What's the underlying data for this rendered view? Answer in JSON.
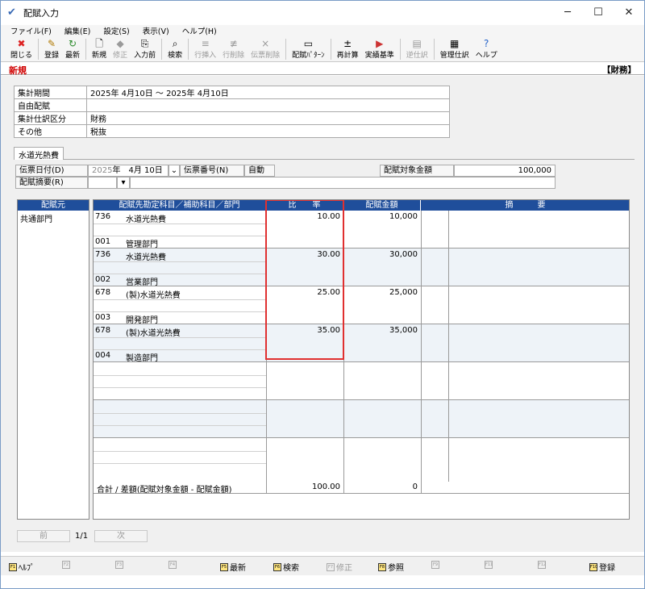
{
  "window": {
    "title": "配賦入力"
  },
  "menu": [
    "ファイル(F)",
    "編集(E)",
    "設定(S)",
    "表示(V)",
    "ヘルプ(H)"
  ],
  "toolbar": [
    {
      "label": "閉じる",
      "icon": "close-icon",
      "enabled": true
    },
    {
      "label": "登録",
      "icon": "save-icon",
      "enabled": true
    },
    {
      "label": "最新",
      "icon": "refresh-icon",
      "enabled": true
    },
    {
      "label": "新規",
      "icon": "new-icon",
      "enabled": true
    },
    {
      "label": "修正",
      "icon": "edit-icon",
      "enabled": false
    },
    {
      "label": "入力前",
      "icon": "prev-input-icon",
      "enabled": true
    },
    {
      "label": "検索",
      "icon": "search-icon",
      "enabled": true
    },
    {
      "label": "行挿入",
      "icon": "row-insert-icon",
      "enabled": false
    },
    {
      "label": "行削除",
      "icon": "row-delete-icon",
      "enabled": false
    },
    {
      "label": "伝票削除",
      "icon": "slip-delete-icon",
      "enabled": false
    },
    {
      "label": "配賦ﾊﾟﾀｰﾝ",
      "icon": "pattern-icon",
      "enabled": true
    },
    {
      "label": "再計算",
      "icon": "recalc-icon",
      "enabled": true
    },
    {
      "label": "実績基準",
      "icon": "actual-icon",
      "enabled": true
    },
    {
      "label": "逆仕訳",
      "icon": "reverse-icon",
      "enabled": false
    },
    {
      "label": "管理仕訳",
      "icon": "manage-icon",
      "enabled": true
    },
    {
      "label": "ヘルプ",
      "icon": "help-icon",
      "enabled": true
    }
  ],
  "status": {
    "mode": "新規",
    "category": "【財務】"
  },
  "info": [
    {
      "label": "集計期間",
      "value": "2025年 4月10日 ～ 2025年 4月10日"
    },
    {
      "label": "自由配賦",
      "value": ""
    },
    {
      "label": "集計仕訳区分",
      "value": "財務"
    },
    {
      "label": "その他",
      "value": "税抜"
    }
  ],
  "tab": "水道光熱費",
  "form": {
    "date_label": "伝票日付(D)",
    "date_year_prefix": "2025",
    "date_value": "年　4月 10日",
    "slip_no_label": "伝票番号(N)",
    "slip_no_value": "自動",
    "target_amount_label": "配賦対象金額",
    "target_amount_value": "100,000",
    "summary_label": "配賦摘要(R)"
  },
  "grid": {
    "source_header": "配賦元",
    "source_value": "共通部門",
    "headers": {
      "dest": "配賦先勘定科目／補助科目／部門",
      "ratio": "比　　率",
      "amount": "配賦金額",
      "memo": "摘　　　要"
    },
    "rows": [
      {
        "acct_code": "736",
        "acct_name": "水道光熱費",
        "dept_code": "001",
        "dept_name": "管理部門",
        "ratio": "10.00",
        "amount": "10,000"
      },
      {
        "acct_code": "736",
        "acct_name": "水道光熱費",
        "dept_code": "002",
        "dept_name": "営業部門",
        "ratio": "30.00",
        "amount": "30,000"
      },
      {
        "acct_code": "678",
        "acct_name": "(製)水道光熱費",
        "dept_code": "003",
        "dept_name": "開発部門",
        "ratio": "25.00",
        "amount": "25,000"
      },
      {
        "acct_code": "678",
        "acct_name": "(製)水道光熱費",
        "dept_code": "004",
        "dept_name": "製造部門",
        "ratio": "35.00",
        "amount": "35,000"
      }
    ],
    "total_label": "合計 / 差額(配賦対象金額 - 配賦金額)",
    "total_ratio": "100.00",
    "total_amount": "0"
  },
  "pager": {
    "prev": "前",
    "page": "1/1",
    "next": "次"
  },
  "fkeys": [
    {
      "key": "F1",
      "label": "ﾍﾙﾌﾟ",
      "enabled": true
    },
    {
      "key": "F2",
      "label": "",
      "enabled": false
    },
    {
      "key": "F3",
      "label": "",
      "enabled": false
    },
    {
      "key": "F4",
      "label": "",
      "enabled": false
    },
    {
      "key": "F5",
      "label": "最新",
      "enabled": true
    },
    {
      "key": "F6",
      "label": "検索",
      "enabled": true
    },
    {
      "key": "F7",
      "label": "修正",
      "enabled": false
    },
    {
      "key": "F8",
      "label": "参照",
      "enabled": true
    },
    {
      "key": "F9",
      "label": "",
      "enabled": false
    },
    {
      "key": "F11",
      "label": "",
      "enabled": false
    },
    {
      "key": "F12",
      "label": "",
      "enabled": false
    },
    {
      "key": "F10",
      "label": "登録",
      "enabled": true
    }
  ]
}
